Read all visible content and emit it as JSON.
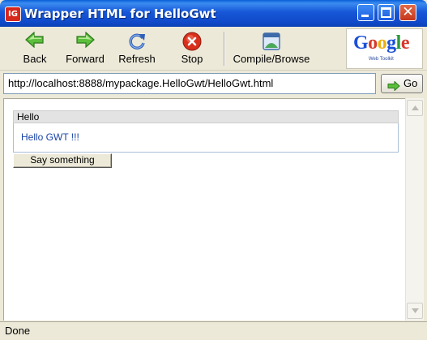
{
  "window": {
    "title": "Wrapper HTML for HelloGwt",
    "icon_text": "IG",
    "close_glyph": "✕"
  },
  "toolbar": {
    "back_label": "Back",
    "forward_label": "Forward",
    "refresh_label": "Refresh",
    "stop_label": "Stop",
    "compile_label": "Compile/Browse"
  },
  "google_logo": {
    "text": "Google",
    "subtext": "Web Toolkit"
  },
  "address": {
    "url": "http://localhost:8888/mypackage.HelloGwt/HelloGwt.html",
    "go_label": "Go"
  },
  "page": {
    "panel_caption": "Hello",
    "panel_text": "Hello GWT !!!",
    "button_label": "Say something"
  },
  "status": {
    "text": "Done"
  },
  "colors": {
    "titlebar": "#0f49c8",
    "nav_arrow": "#3aa23a",
    "stop": "#d9301c",
    "link_text": "#1a44a8"
  },
  "icons": {
    "back": "back-arrow-icon",
    "forward": "forward-arrow-icon",
    "refresh": "refresh-icon",
    "stop": "stop-icon",
    "compile": "compile-browse-icon",
    "go": "go-arrow-icon"
  }
}
